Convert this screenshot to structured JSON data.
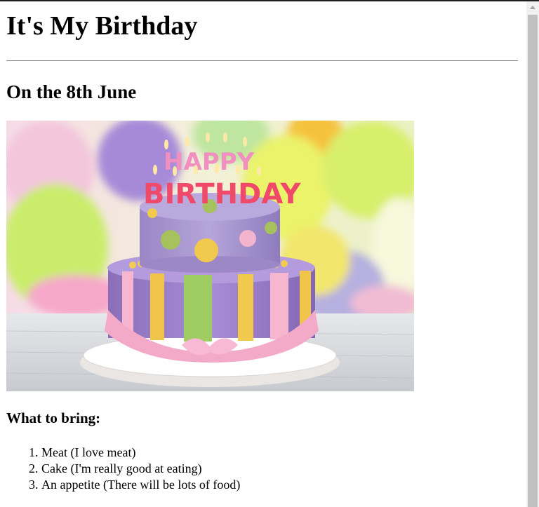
{
  "page": {
    "title": "It's My Birthday",
    "subtitle": "On the 8th June",
    "image": {
      "icon": "birthday-cake-photo",
      "candles_text": [
        "HAPPY",
        "BIRTHDAY"
      ]
    },
    "list_heading": "What to bring:",
    "items": [
      "Meat (I love meat)",
      "Cake (I'm really good at eating)",
      "An appetite (There will be lots of food)"
    ]
  },
  "colors": {
    "text": "#000000",
    "rule": "#8a8a8a",
    "scrollbar_track": "#f1f1f1",
    "scrollbar_thumb": "#c1c1c1"
  }
}
